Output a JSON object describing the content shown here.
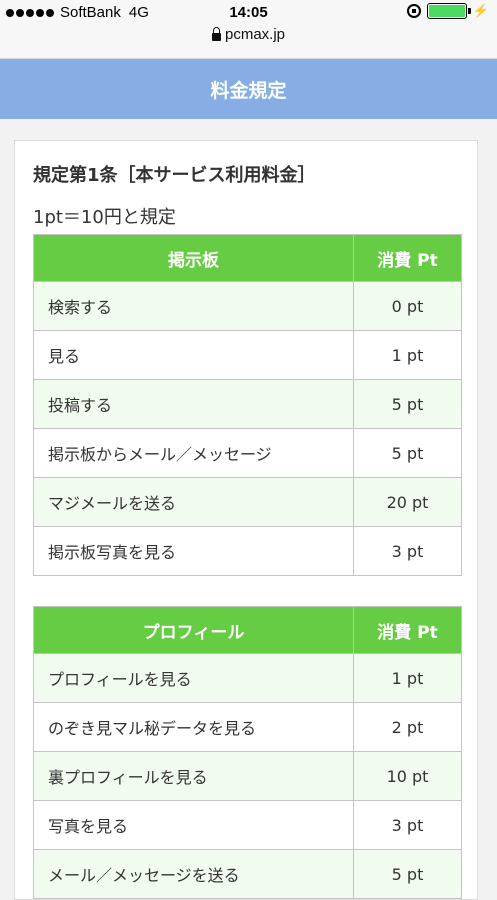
{
  "status_bar": {
    "carrier": "SoftBank",
    "network": "4G",
    "time": "14:05",
    "icons": [
      "signal-dots-icon",
      "rotation-lock-icon",
      "battery-icon",
      "charging-bolt-icon"
    ],
    "battery_color": "#4cd964"
  },
  "url_bar": {
    "url": "pcmax.jp",
    "icon": "lock-icon"
  },
  "header": {
    "title": "料金規定",
    "background": "#86aee4"
  },
  "content": {
    "section_title": "規定第1条［本サービス利用料金］",
    "rate_text": "1pt＝10円と規定",
    "table_header_color": "#66cc44",
    "tables": [
      {
        "header": "掲示板",
        "cost_header": "消費 Pt",
        "rows": [
          {
            "item": "検索する",
            "pt": "0 pt"
          },
          {
            "item": "見る",
            "pt": "1 pt"
          },
          {
            "item": "投稿する",
            "pt": "5 pt"
          },
          {
            "item": "掲示板からメール／メッセージ",
            "pt": "5 pt"
          },
          {
            "item": "マジメールを送る",
            "pt": "20 pt"
          },
          {
            "item": "掲示板写真を見る",
            "pt": "3 pt"
          }
        ]
      },
      {
        "header": "プロフィール",
        "cost_header": "消費 Pt",
        "rows": [
          {
            "item": "プロフィールを見る",
            "pt": "1 pt"
          },
          {
            "item": "のぞき見マル秘データを見る",
            "pt": "2 pt"
          },
          {
            "item": "裏プロフィールを見る",
            "pt": "10 pt"
          },
          {
            "item": "写真を見る",
            "pt": "3 pt"
          },
          {
            "item": "メール／メッセージを送る",
            "pt": "5 pt"
          }
        ]
      }
    ]
  }
}
